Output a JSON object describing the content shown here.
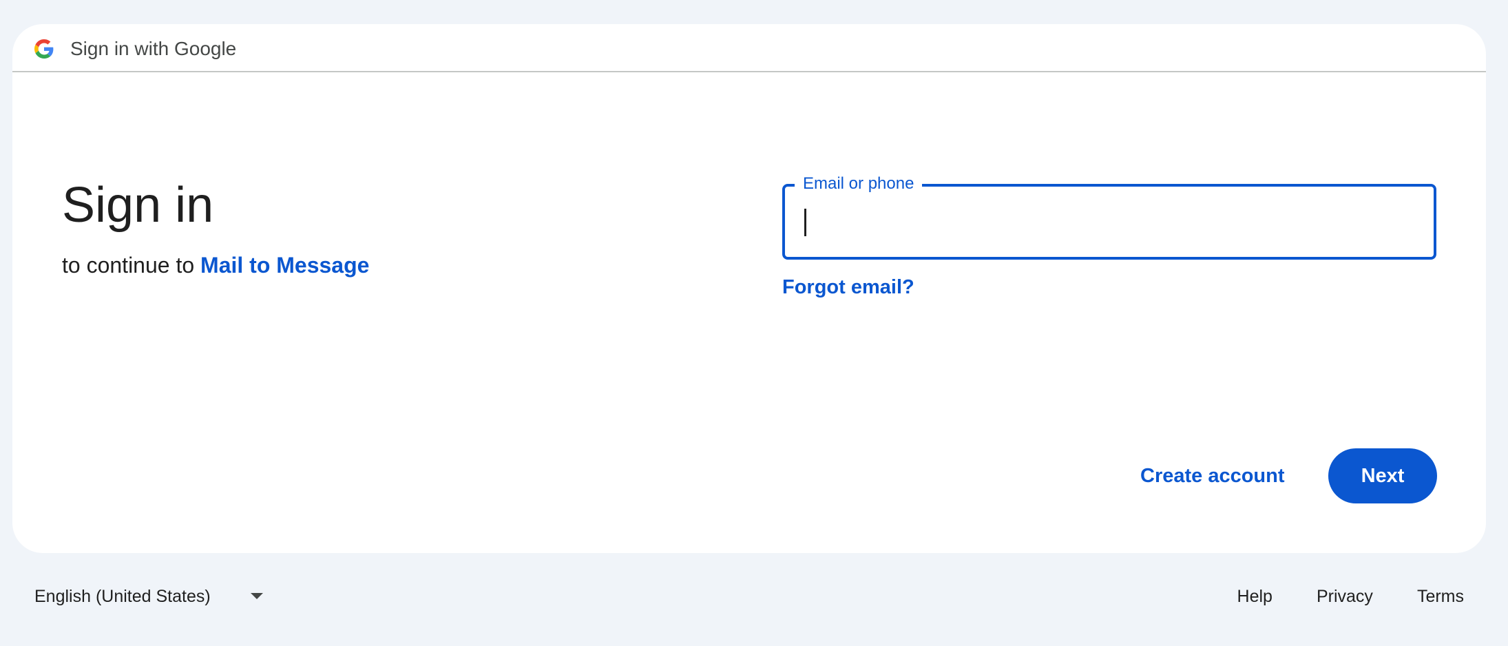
{
  "header": {
    "title": "Sign in with Google",
    "logo_icon": "google-g-icon"
  },
  "main": {
    "title": "Sign in",
    "subtitle_prefix": "to continue to",
    "app_name": "Mail to Message"
  },
  "form": {
    "email_label": "Email or phone",
    "email_value": "",
    "forgot_email": "Forgot email?"
  },
  "actions": {
    "create_account": "Create account",
    "next": "Next"
  },
  "footer": {
    "language": "English (United States)",
    "language_icon": "dropdown-arrow-icon",
    "links": [
      "Help",
      "Privacy",
      "Terms"
    ]
  },
  "colors": {
    "accent": "#0b57d0",
    "background": "#f0f4f9",
    "card": "#ffffff",
    "text": "#1f1f1f"
  }
}
